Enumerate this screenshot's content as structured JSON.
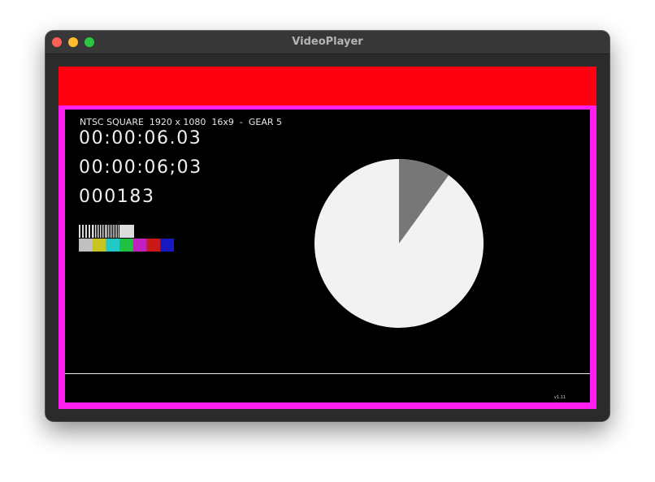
{
  "window": {
    "title": "VideoPlayer"
  },
  "colors": {
    "top_bar": "#ff0010",
    "frame": "#ff20f0",
    "video_background": "#000000",
    "pie_main": "#f2f2f2",
    "pie_slice": "#777777"
  },
  "overlay": {
    "format_label": "NTSC SQUARE  1920 x 1080  16x9  -  GEAR 5",
    "timecode_drop_frame_dot": "00:00:06.03",
    "timecode_drop_frame_semicolon": "00:00:06;03",
    "frame_count": "000183",
    "version": "v1.11"
  },
  "color_bars": {
    "colors": [
      "#c0c0c0",
      "#c8c420",
      "#20c8c8",
      "#20c040",
      "#c020c0",
      "#c81818",
      "#1818c0"
    ]
  },
  "progress_pie": {
    "elapsed_fraction": 0.1
  }
}
